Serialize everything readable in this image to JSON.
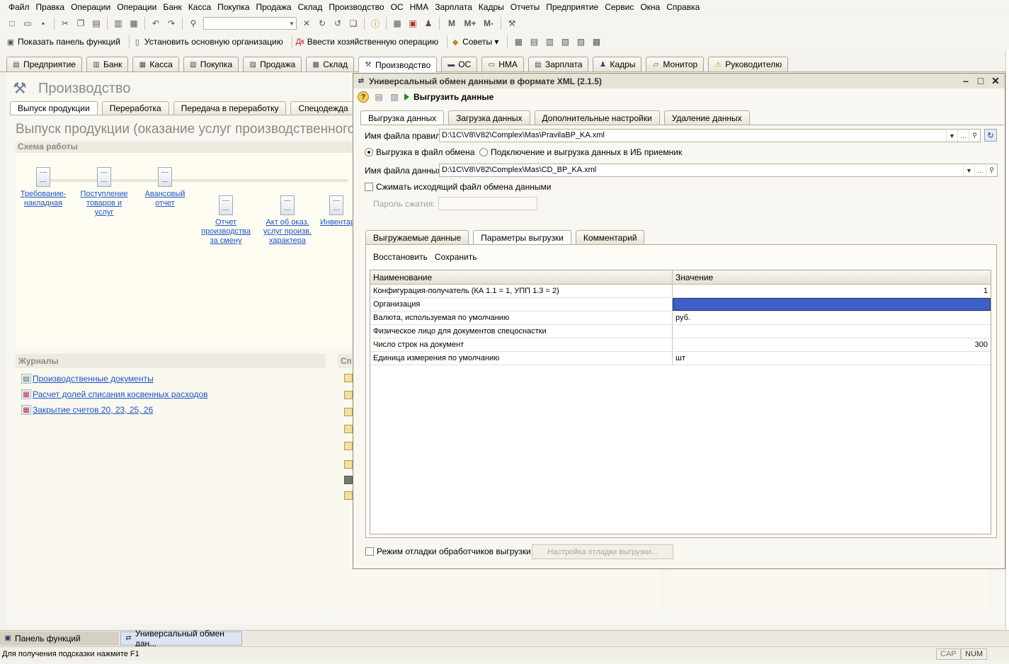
{
  "menu": [
    "Файл",
    "Правка",
    "Операции",
    "Операции",
    "Банк",
    "Касса",
    "Покупка",
    "Продажа",
    "Склад",
    "Производство",
    "ОС",
    "НМА",
    "Зарплата",
    "Кадры",
    "Отчеты",
    "Предприятие",
    "Сервис",
    "Окна",
    "Справка"
  ],
  "toolbar1": {
    "m_label": "M",
    "mplus_label": "M+",
    "mminus_label": "M-"
  },
  "toolbar2": {
    "show_panel": "Показать панель функций",
    "set_org": "Установить основную организацию",
    "enter_op": "Ввести хозяйственную операцию",
    "tips": "Советы"
  },
  "section_tabs": [
    "Предприятие",
    "Банк",
    "Касса",
    "Покупка",
    "Продажа",
    "Склад",
    "Производство",
    "ОС",
    "НМА",
    "Зарплата",
    "Кадры",
    "Монитор",
    "Руководителю"
  ],
  "background": {
    "title": "Производство",
    "inner_tabs": [
      "Выпуск продукции",
      "Переработка",
      "Передача в переработку",
      "Спецодежда"
    ],
    "heading": "Выпуск продукции (оказание услуг производственного характера)",
    "scheme_label": "Схема работы",
    "docs": [
      "Требование-накладная",
      "Поступление товаров и услуг",
      "Авансовый отчет",
      "Отчет производства за смену",
      "Акт об оказ. услуг произв. характера",
      "Инвентаризация незавершенного производства"
    ],
    "journals_label": "Журналы",
    "journals": [
      "Производственные документы",
      "Расчет долей списания косвенных расходов",
      "Закрытие счетов 20, 23, 25, 26"
    ],
    "spr_label": "Справочники"
  },
  "dialog": {
    "title": "Универсальный обмен данными в формате XML (2.1.5)",
    "run_label": "Выгрузить данные",
    "tabs": [
      "Выгрузка данных",
      "Загрузка данных",
      "Дополнительные настройки",
      "Удаление данных"
    ],
    "rules_file_label": "Имя файла правил:",
    "rules_file_value": "D:\\1C\\V8\\V82\\Complex\\Mas\\PravilaBP_KA.xml",
    "radio_file": "Выгрузка в файл обмена",
    "radio_ib": "Подключение и выгрузка данных в ИБ приемник",
    "data_file_label": "Имя файла данных:",
    "data_file_value": "D:\\1C\\V8\\V82\\Complex\\Mas\\CD_BP_KA.xml",
    "compress_label": "Сжимать исходящий файл обмена данными",
    "password_label": "Пароль сжатия:",
    "subtabs": [
      "Выгружаемые данные",
      "Параметры выгрузки",
      "Комментарий"
    ],
    "restore_label": "Восстановить",
    "save_label": "Сохранить",
    "grid_headers": [
      "Наименование",
      "Значение"
    ],
    "grid_rows": [
      {
        "name": "Конфигурация-получатель (КА 1.1 = 1, УПП 1.3 = 2)",
        "value": "1"
      },
      {
        "name": "Организация",
        "value": ""
      },
      {
        "name": "Валюта, используемая по умолчанию",
        "value": "руб."
      },
      {
        "name": "Физическое лицо для документов спецоснастки",
        "value": ""
      },
      {
        "name": "Число строк на документ",
        "value": "300"
      },
      {
        "name": "Единица измерения по умолчанию",
        "value": "шт"
      }
    ],
    "debug_label": "Режим отладки обработчиков выгрузки",
    "debug_btn": "Настройка отладки выгрузки..."
  },
  "taskbar": [
    "Панель функций",
    "Универсальный обмен дан..."
  ],
  "status": {
    "hint": "Для получения подсказки нажмите F1",
    "cap": "CAP",
    "num": "NUM"
  },
  "colors": {
    "selection": "#3e5fc6",
    "link": "#1a53c9",
    "run": "#1d8a1d"
  }
}
